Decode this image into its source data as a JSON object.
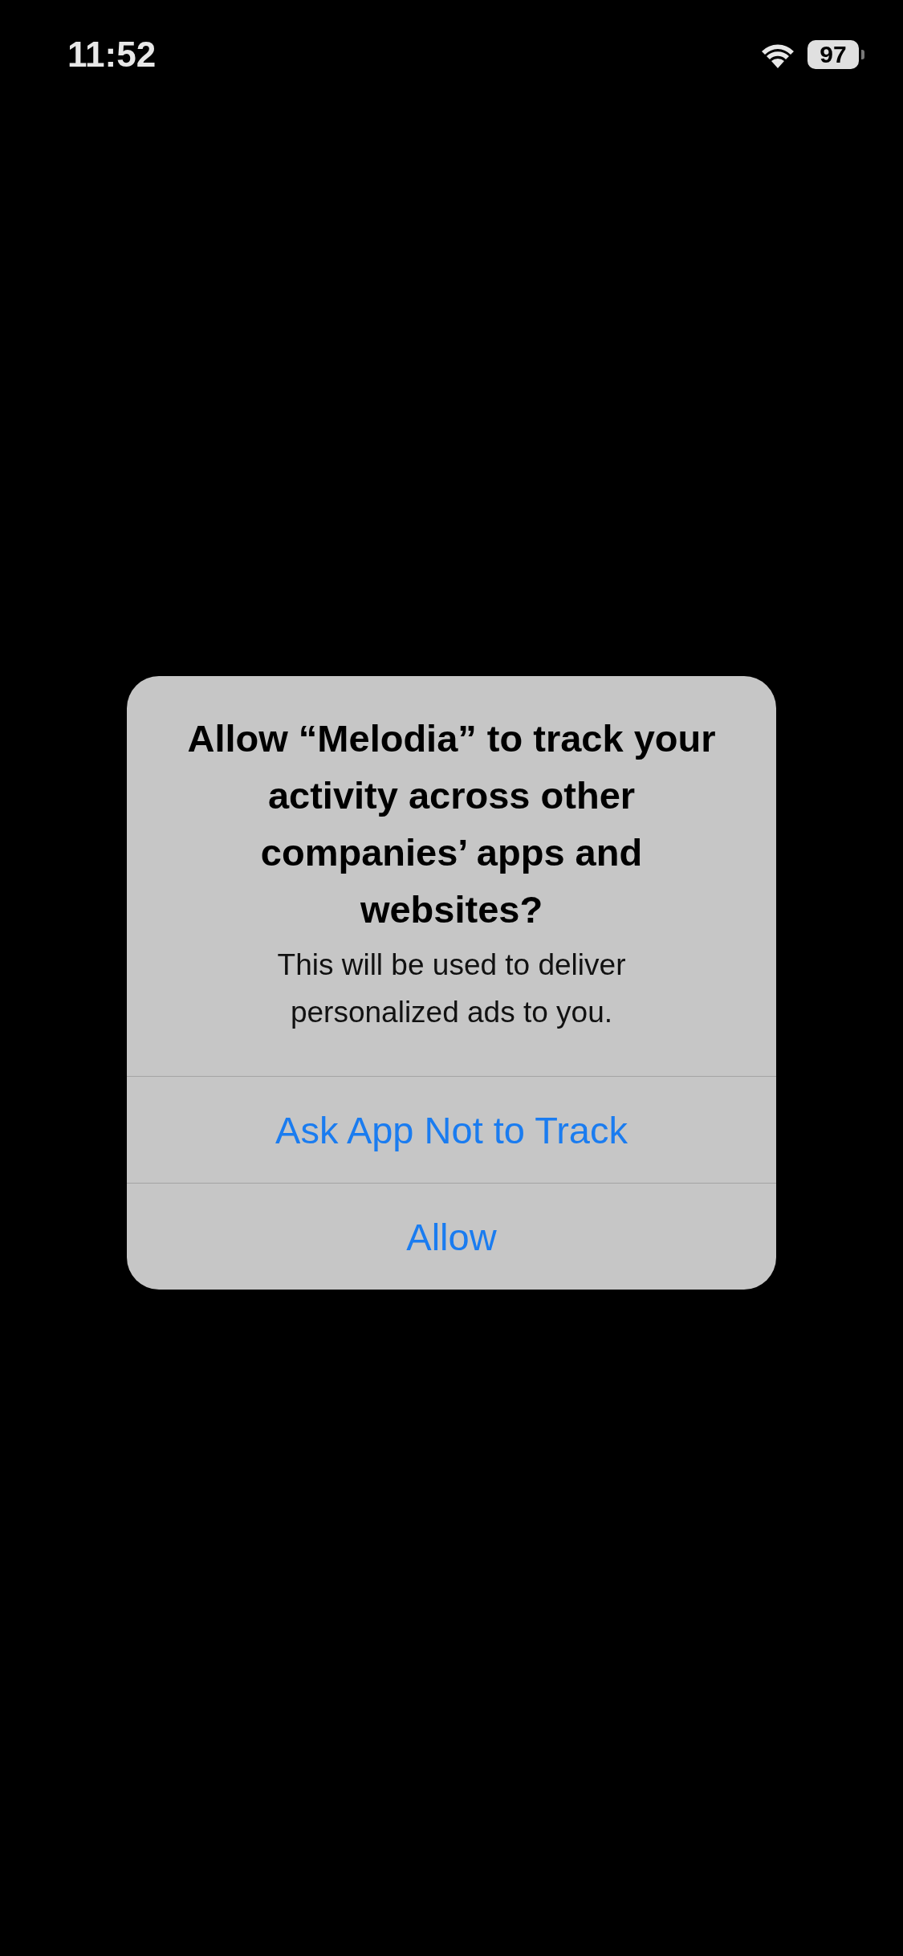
{
  "status_bar": {
    "time": "11:52",
    "battery": "97"
  },
  "alert": {
    "title": "Allow “Melodia” to track your activity across other companies’ apps and websites?",
    "message": "This will be used to deliver personalized ads to you.",
    "buttons": [
      {
        "label": "Ask App Not to Track"
      },
      {
        "label": "Allow"
      }
    ]
  }
}
